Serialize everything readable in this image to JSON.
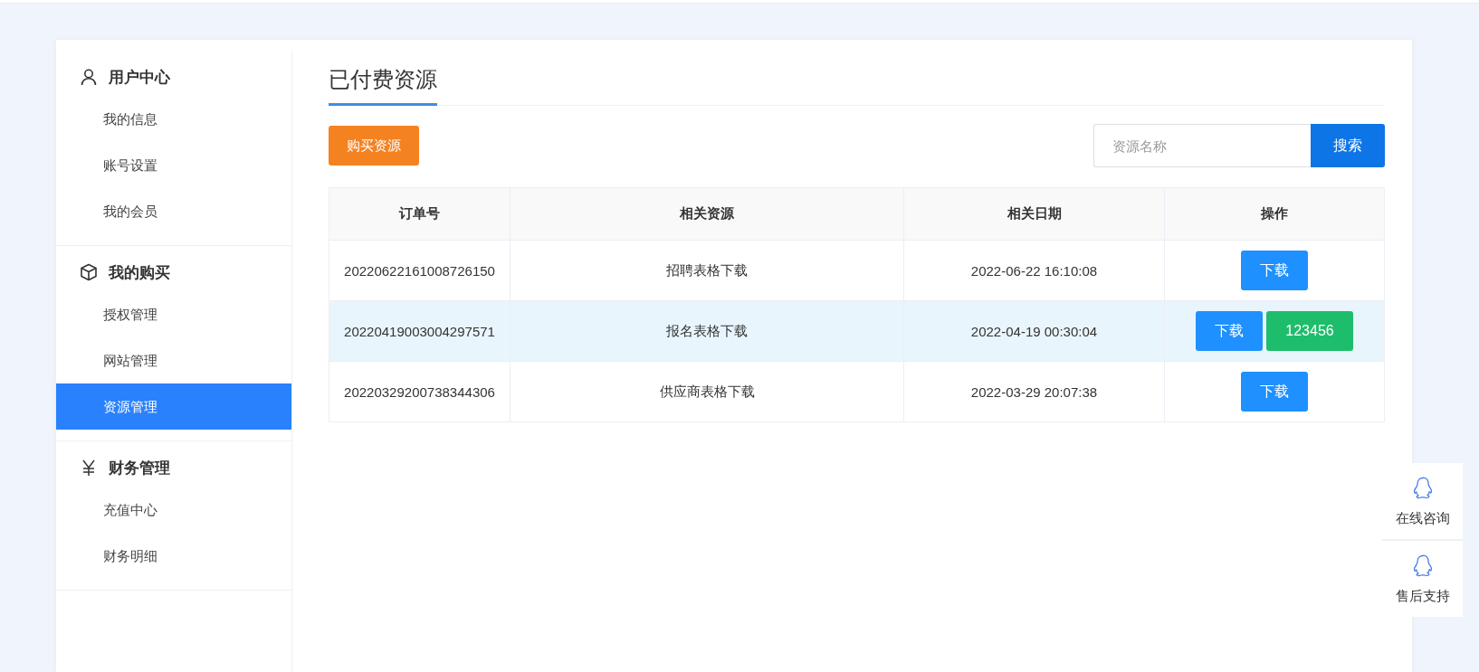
{
  "sidebar": {
    "groups": [
      {
        "title": "用户中心",
        "kind": "user",
        "items": [
          {
            "label": "我的信息",
            "selected": false
          },
          {
            "label": "账号设置",
            "selected": false
          },
          {
            "label": "我的会员",
            "selected": false
          }
        ]
      },
      {
        "title": "我的购买",
        "kind": "box",
        "items": [
          {
            "label": "授权管理",
            "selected": false
          },
          {
            "label": "网站管理",
            "selected": false
          },
          {
            "label": "资源管理",
            "selected": true
          }
        ]
      },
      {
        "title": "财务管理",
        "kind": "yen",
        "items": [
          {
            "label": "充值中心",
            "selected": false
          },
          {
            "label": "财务明细",
            "selected": false
          }
        ]
      }
    ]
  },
  "page_title": "已付费资源",
  "buy_button": "购买资源",
  "search": {
    "placeholder": "资源名称",
    "button": "搜索"
  },
  "table": {
    "columns": [
      "订单号",
      "相关资源",
      "相关日期",
      "操作"
    ],
    "rows": [
      {
        "order": "20220622161008726150",
        "resource": "招聘表格下载",
        "date": "2022-06-22 16:10:08",
        "selected": false,
        "actions": [
          {
            "kind": "download",
            "label": "下载"
          }
        ]
      },
      {
        "order": "20220419003004297571",
        "resource": "报名表格下载",
        "date": "2022-04-19 00:30:04",
        "selected": true,
        "actions": [
          {
            "kind": "download",
            "label": "下载"
          },
          {
            "kind": "code",
            "label": "123456"
          }
        ]
      },
      {
        "order": "20220329200738344306",
        "resource": "供应商表格下载",
        "date": "2022-03-29 20:07:38",
        "selected": false,
        "actions": [
          {
            "kind": "download",
            "label": "下载"
          }
        ]
      }
    ]
  },
  "float_panel": [
    {
      "label": "在线咨询"
    },
    {
      "label": "售后支持"
    }
  ]
}
